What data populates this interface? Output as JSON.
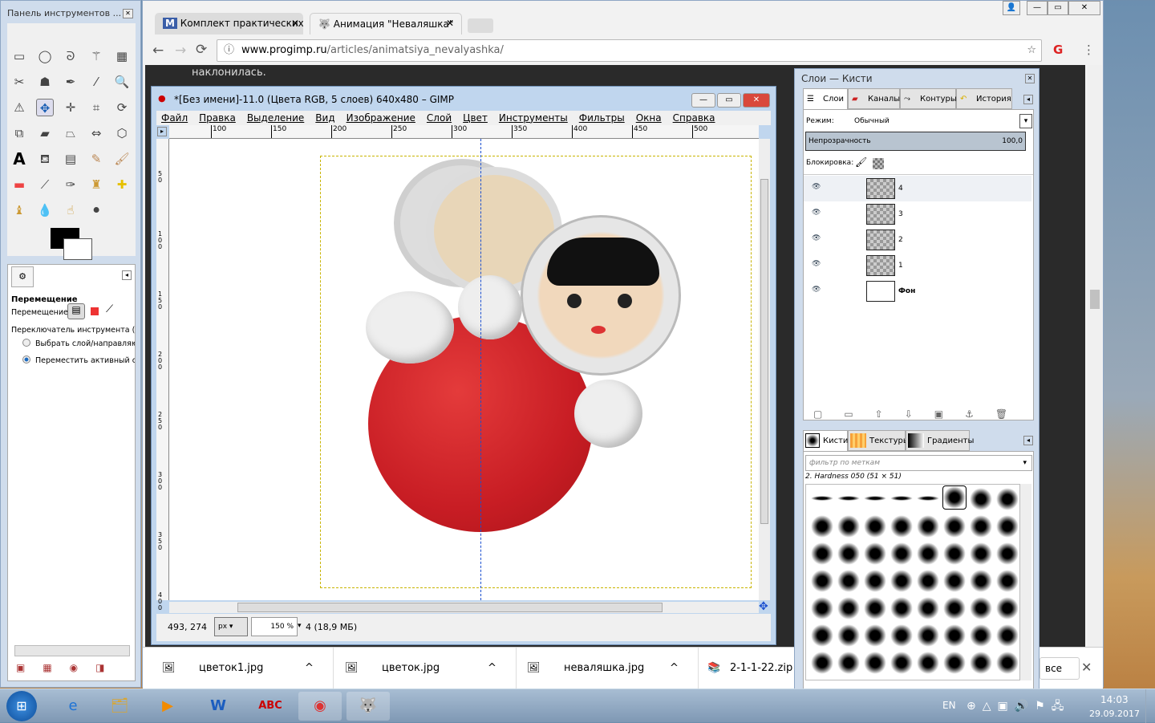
{
  "toolbox": {
    "title": "Панель инструментов ...",
    "options_title": "Перемещение",
    "move_label": "Перемещение:",
    "switch_label": "Переключатель инструмента  (Sh",
    "radio1": "Выбрать слой/направляю",
    "radio2": "Переместить активный сл"
  },
  "browser": {
    "tabs": [
      {
        "label": "Комплект практических",
        "icon": "M"
      },
      {
        "label": "Анимация \"Неваляшка\""
      }
    ],
    "url_host": "www.progimp.ru",
    "url_path": "/articles/animatsiya_nevalyashka/",
    "page_text": "наклонилась.",
    "downloads": [
      "цветок1.jpg",
      "цветок.jpg",
      "неваляшка.jpg",
      "2-1-1-22.zip"
    ],
    "show_all": "все"
  },
  "gimp": {
    "title": "*[Без имени]-11.0 (Цвета RGB, 5 слоев) 640x480 – GIMP",
    "menu": [
      "Файл",
      "Правка",
      "Выделение",
      "Вид",
      "Изображение",
      "Слой",
      "Цвет",
      "Инструменты",
      "Фильтры",
      "Окна",
      "Справка"
    ],
    "ruler_ticks": [
      "100",
      "150",
      "200",
      "250",
      "300",
      "350",
      "400",
      "450",
      "500"
    ],
    "vruler_ticks": [
      "50",
      "100",
      "150",
      "200",
      "250",
      "300",
      "350",
      "400"
    ],
    "coords": "493, 274",
    "unit": "px",
    "zoom": "150 %",
    "status": "4 (18,9 МБ)"
  },
  "dock": {
    "title": "Слои — Кисти",
    "tabs": [
      "Слои",
      "Каналы",
      "Контуры",
      "История"
    ],
    "mode_label": "Режим:",
    "mode_value": "Обычный",
    "opacity_label": "Непрозрачность",
    "opacity_value": "100,0",
    "lock_label": "Блокировка:",
    "layers": [
      "4",
      "3",
      "2",
      "1",
      "Фон"
    ],
    "brush_tabs": [
      "Кисти",
      "Текстуры",
      "Градиенты"
    ],
    "filter_placeholder": "фильтр по меткам",
    "brush_name": "2. Hardness 050 (51 × 51)"
  },
  "taskbar": {
    "lang": "EN",
    "time": "14:03",
    "date": "29.09.2017"
  }
}
